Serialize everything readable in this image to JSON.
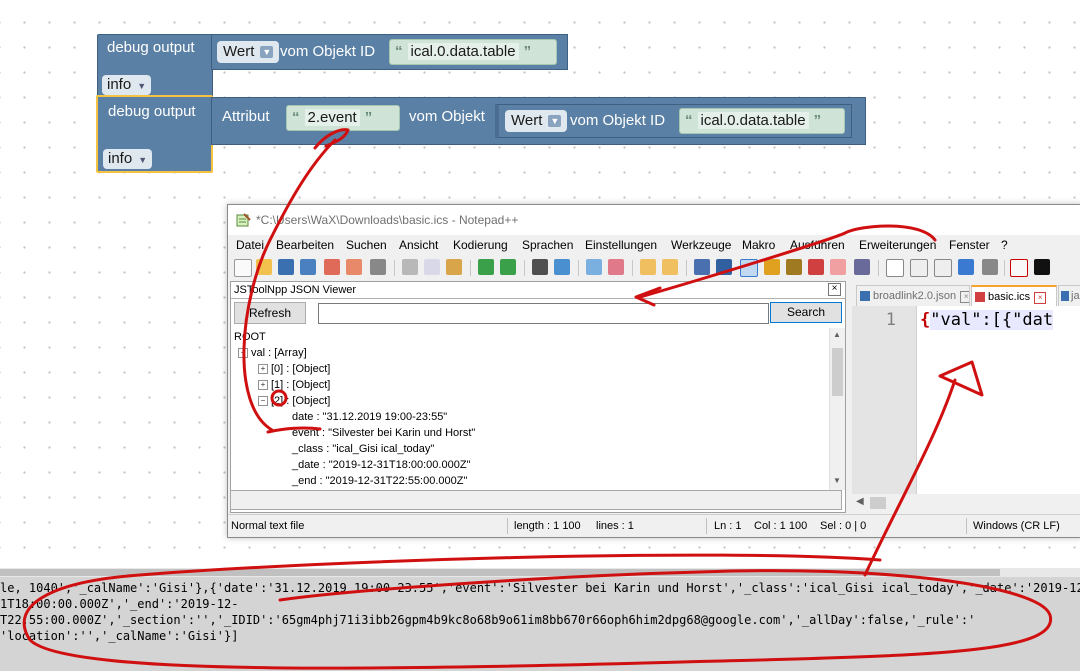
{
  "blockly": {
    "block1": {
      "title": "debug output",
      "wert_label": "Wert",
      "vom_objekt_id": "vom Objekt ID",
      "object_id": "ical.0.data.table",
      "level": "info"
    },
    "block2": {
      "title": "debug output",
      "attribut_label": "Attribut",
      "attribut_value": "2.event",
      "vom_objekt": "vom Objekt",
      "wert_label": "Wert",
      "vom_objekt_id": "vom Objekt ID",
      "object_id": "ical.0.data.table",
      "level": "info"
    }
  },
  "notepad": {
    "title": "*C:\\Users\\WaX\\Downloads\\basic.ics - Notepad++",
    "menu": [
      "Datei",
      "Bearbeiten",
      "Suchen",
      "Ansicht",
      "Kodierung",
      "Sprachen",
      "Einstellungen",
      "Werkzeuge",
      "Makro",
      "Ausführen",
      "Erweiterungen",
      "Fenster",
      "?"
    ],
    "json_viewer": {
      "title": "JSToolNpp JSON Viewer",
      "refresh_label": "Refresh",
      "search_label": "Search",
      "search_value": "",
      "tree": [
        {
          "text": "ROOT",
          "expander": ""
        },
        {
          "text": "val : [Array]",
          "expander": "−"
        },
        {
          "text": "[0] : [Object]",
          "expander": "+"
        },
        {
          "text": "[1] : [Object]",
          "expander": "+"
        },
        {
          "text": "[2] : [Object]",
          "expander": "−"
        },
        {
          "text": "date : \"31.12.2019 19:00-23:55\"",
          "expander": ""
        },
        {
          "text": "event : \"Silvester bei Karin und Horst\"",
          "expander": ""
        },
        {
          "text": "_class : \"ical_Gisi ical_today\"",
          "expander": ""
        },
        {
          "text": "_date : \"2019-12-31T18:00:00.000Z\"",
          "expander": ""
        },
        {
          "text": "_end : \"2019-12-31T22:55:00.000Z\"",
          "expander": ""
        }
      ]
    },
    "tabs": [
      {
        "label": "broadlink2.0.json",
        "active": false
      },
      {
        "label": "basic.ics",
        "active": true
      },
      {
        "label": "ja",
        "active": false
      }
    ],
    "editor": {
      "line_number": "1",
      "brace": "{",
      "code_text": "\"val\":[{\"dat"
    },
    "status": {
      "file_type": "Normal text file",
      "length": "length : 1 100",
      "lines": "lines : 1",
      "ln": "Ln : 1",
      "col": "Col : 1 100",
      "sel": "Sel : 0 | 0",
      "eol": "Windows (CR LF)"
    }
  },
  "log": {
    "lines": [
      "le, 1040','_calName':'Gisi'},{'date':'31.12.2019 19:00-23:55','event':'Silvester bei Karin und Horst','_class':'ical_Gisi ical_today','_date':'2019-12-",
      "1T18:00:00.000Z','_end':'2019-12-",
      "T22:55:00.000Z','_section':'','_IDID':'65gm4phj71i3ibb26gpm4b9kc8o68b9o61im8bb670r66oph6him2dpg68@google.com','_allDay':false,'_rule':'",
      "'location':'','_calName':'Gisi'}]"
    ]
  },
  "colors": {
    "block_blue": "#5b80a5",
    "selection_yellow": "#f5c242",
    "text_block_green": "#cfe3d7",
    "annotation_red": "#d01010"
  }
}
